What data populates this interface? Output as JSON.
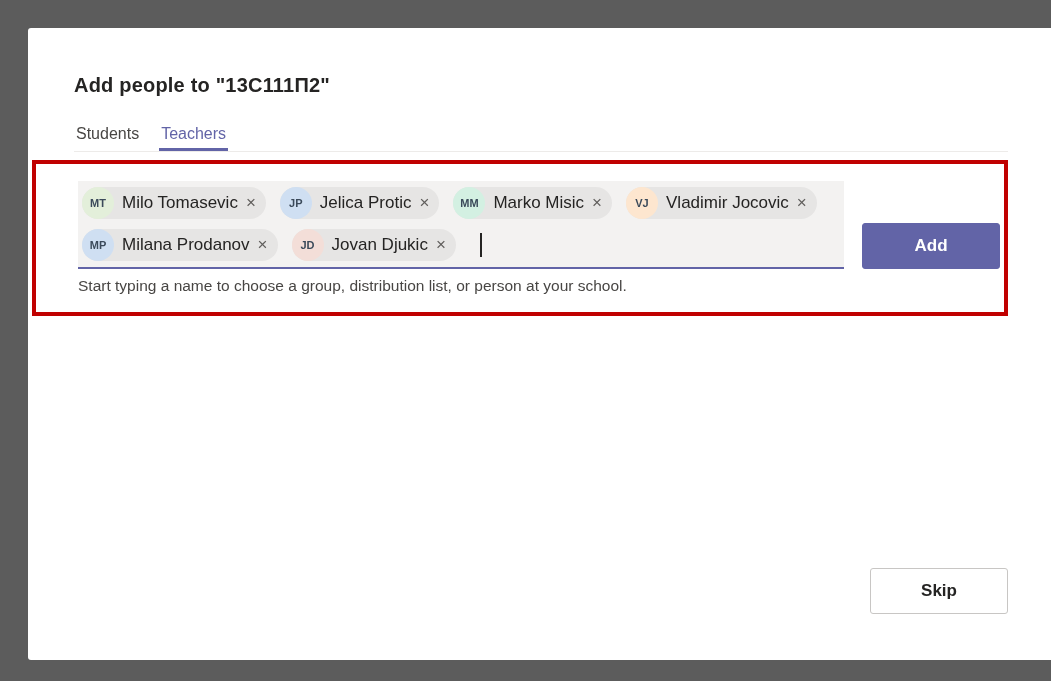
{
  "dialog": {
    "title": "Add people to \"13C111П2\"",
    "tabs": [
      {
        "label": "Students",
        "selected": false
      },
      {
        "label": "Teachers",
        "selected": true
      }
    ],
    "people_picker": {
      "chips": [
        {
          "initials": "MT",
          "name": "Milo Tomasevic",
          "remove": "×",
          "color": "#e3efda"
        },
        {
          "initials": "JP",
          "name": "Jelica Protic",
          "remove": "×",
          "color": "#cfdff2"
        },
        {
          "initials": "MM",
          "name": "Marko Misic",
          "remove": "×",
          "color": "#d3f0e2"
        },
        {
          "initials": "VJ",
          "name": "Vladimir Jocovic",
          "remove": "×",
          "color": "#fde6cf"
        },
        {
          "initials": "MP",
          "name": "Milana Prodanov",
          "remove": "×",
          "color": "#cfdff2"
        },
        {
          "initials": "JD",
          "name": "Jovan Djukic",
          "remove": "×",
          "color": "#f3ded8"
        }
      ],
      "hint": "Start typing a name to choose a group, distribution list, or person at your school.",
      "highlighted": true
    },
    "add_button": "Add",
    "skip_button": "Skip"
  }
}
